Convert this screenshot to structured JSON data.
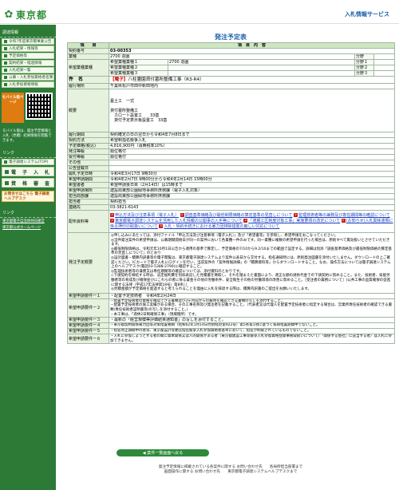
{
  "header": {
    "logo_text": "東京都",
    "logo_icon": "tokyo-emblem",
    "system_title": "入札情報サービス"
  },
  "sidebar": {
    "section1": "調達情報",
    "items1": [
      "令和7年度東京都事業公告",
      "入札結果・情報等",
      "予定価格等",
      "契約結果・経過情報",
      "入札結果一覧",
      "公募・入札参加資格者名簿",
      "入札参加資格情報"
    ],
    "mobile_badge": "モバイル版ページ",
    "note": "モバイル版は、発注予定情報と入札（見積）結果情報を閲覧できます。",
    "section2": "リンク",
    "items2": [
      "電子調達システム(TOP)"
    ],
    "big_items": [
      "電　子　入　札",
      "資　格　審　査"
    ],
    "help_label": "お問合せはこちら 電子調達ヘルプデスク",
    "section3": "リンク",
    "links": [
      "東京都電子自治体共同運営",
      "東京都公式ホームページ"
    ]
  },
  "page_title": "発注予定表",
  "table": {
    "col_item": "項　　目",
    "col_content": "項　目　内　容",
    "rows": {
      "no_label": "契約番号",
      "no_value": "03-00353",
      "business_label": "業種",
      "business_value": "2700 造園",
      "bunya": "分野",
      "hope_label": "希望業種業種",
      "hope1": "希望業種業種１",
      "hope1_value": "2700 造園",
      "hope2": "希望業種業種２",
      "hope3": "希望業種業種３",
      "bunya1": "分野１",
      "bunya2": "分野２",
      "bunya3": "分野３",
      "name_label": "件　名",
      "name_prefix": "【電子】",
      "name_value": "八柱霊園貸付墓所整備工事（R3-R4）",
      "place_label": "履行場所",
      "place_value": "千葉県松戸市田中新田地内",
      "summary_label": "概要",
      "summary_value": "墓土工　一式\n\n貸付墓所整備工\n　カロート設置工　　33基\n　貸付予定表示板設置工　33基",
      "period_label": "履行期間",
      "period_value": "契約確定の日の翌日から令和4年7月8日まで",
      "method_label": "契約方法",
      "method_value": "希望制指名競争入札",
      "price_label": "予定価格(税込)",
      "price_value": "4,816,900円（消費税率10%）",
      "issuer_label": "発注等級",
      "issuer_value": "順位格付",
      "receive_label": "受付等級",
      "receive_value": "順位格付",
      "other_label": "その他",
      "pub_label": "公告登載日",
      "pub_value": "",
      "open_label": "開札予定日時",
      "open_value": "令和4年3月17日 9時30分",
      "apply_label": "希望申請期間",
      "apply_value": "令和4年2月7日 9時00分から令和4年2月14日 15時00分",
      "notice_label": "希望書者",
      "notice_value": "希望申請後日目（2月14日）は15時まで",
      "applyplace_label": "希望申請場所",
      "applyplace_value": "建設局東部公園緑地事務所庶務課（電子入札対象）",
      "dept_label": "担当局部課",
      "dept_value": "建設局東部公園緑地事務所庶務課",
      "charge_label": "担当者",
      "charge_value": "契約担当",
      "contact_label": "連絡先",
      "contact_value": "03-3821-6143",
      "docs_label": "配布資料等",
      "docs": [
        "申込方法及び注意事項（電子入札）",
        "調査基準価格及び最低制限価格の算定基準の見直しについて",
        "監理技術者等の兼務及び専任期間等の確認について",
        "東京都電子調達システムを活用した入札情報の公開事の入手等について",
        "「適期工区制度対象工事」実施要領の改定について",
        "(お知らせ)入札関係書類に係る押印の取扱いについて",
        "入札・契約手続きにおける暴力団排除措置の厳しい対応について"
      ],
      "notes_label": "発注予定概要",
      "notes_value": "◎申し込みにあたっては、添付ファイル「申込方法及び注意事項（電子入札）」及び「希望書等」を参照し、希望申請をおこなってください。\n◎当件発注案件の希望申請は、公募期間開始日が同一の案件において各業種一件のみです。同一業種に複数の希望申請を行った場合は、原則すべて無効扱いとさせていただきます。\n◎最低制限価格は、令和元年10月1日公告から適用の基準で算定し、予定価格の7/10から9.2/10までの範囲で設定する。詳細は別添「調査基準価格及び最低制限価格の算定基準の見直しについて」のとおり\n◎設計図書・積算内訳書等の電子閲覧は、東京都電子調達システムより案件公表日から交付する。指名通知時には、原則発注図書を添付いたしません。ダウンロードの上ご確認ください。ICカードで電子入札にログインを行い、当該案件の「案件情報詳細」の「積算資料等」からダウンロードすること。なお、操作方法については電子調達システム上のヘルプデスク(電話03-5388-2790)に確認すること。\n◎監理技術者等の兼務又は専任期間等の確認については、添付資料のとおりです。\n◇下請契約を締結する時は、法定福利費を別枠表記した見積書を徴取し、それを踏まえた書面により、適正な額の請負代金での下請契約に努めること。また、技術者、技能労働者等の育成及び確保並びにこれらの者に係る賃金その他の労働条件、安全衛生その他の労働環境の改善に努めること。［受注者の責務について］(公共工事の品質確保の促進に関する法律（平成17年法律第18号）第8条）］\n◎見積金額が予定価格を超過すると考えられることを理由に入札を辞退する際は、積算内訳書のご提出をお願いいたします。",
      "req1_label": "希望申請要件一１",
      "req1_value": "・配置予定技術者　令和4年2月24日",
      "req2_label": "希望申請要件一２",
      "req2_value": "・配置予定技術者の資格を確認できる書類及び3ヶ月前からの雇用を確認できる書類の写しを添付すること。\n・配置予定技術者の施工実績がある場合、その工事名称及び発注者を記載すること。（代表者又は代理人を配置予定技術者に指定する場合は、営業所専任技術者の確認できる書類(専任技術者証明書等)の写しを添付すること。）\n・本工事は、「適休2日制確保工事」（現場閉所）です。",
      "req3_label": "希望申請要件一３",
      "req3_value": "・最新の「経営規模等評価結果通知書」の写しを添付すること。",
      "req4_label": "希望申請要件一４",
      "req4_value": "・東京都契約関係暴力団等対策措置要綱（昭和62年1月14日付財経庶第922号）第5条第1項に基づく排除措置期間中でないこと。",
      "req5_label": "希望申請要件一５",
      "req5_value": "・指名停止期間中の者等、東京都設計等委託指名競争入札参加資格者基準において、指名が制限されているものでないこと。",
      "req6_label": "希望申請要件一６",
      "req6_value": "・入札に参加しようとする者の間に資本関係又は人的関係がある者（東京都建設工事等競争入札参加資格登録事務取扱いについて）「関係する会社」に該当する者）は入札に参加できません。"
    }
  },
  "back_button": "案件一覧画面へ戻る",
  "footer": {
    "line1": "発注予定情報に掲載されている各案件に関する お問い合わせ先　　各局所担当部署まで",
    "line2": "画面操作に関する お問い合わせ先　　東京都電子調達システムヘルプデスクまで"
  }
}
